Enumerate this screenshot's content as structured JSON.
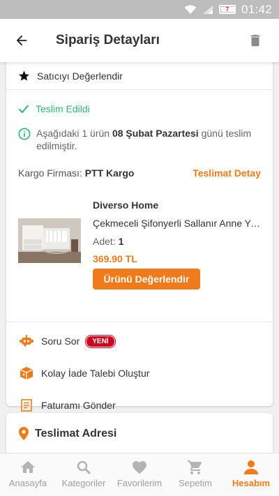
{
  "status_bar": {
    "time": "01:42",
    "battery_level": "7"
  },
  "header": {
    "title": "Sipariş Detayları",
    "back_icon": "arrow-back-icon",
    "delete_icon": "trash-icon"
  },
  "rate_seller": {
    "label": "Satıcıyı Değerlendir"
  },
  "delivery": {
    "status": "Teslim Edildi",
    "status_color": "#2eb872",
    "info_prefix": "Aşağıdaki 1 ürün",
    "info_date": "08 Şubat Pazartesi",
    "info_suffix": "günü teslim edilmiştir."
  },
  "cargo": {
    "label": "Kargo Firması:",
    "company": "PTT Kargo",
    "detail_link": "Teslimat Detay"
  },
  "product": {
    "brand": "Diverso Home",
    "name": "Çekmeceli Şifonyerli Sallanır Anne Yanı Bebek Beşiği",
    "qty_label": "Adet:",
    "qty": "1",
    "price": "369.90 TL",
    "rate_button": "Ürünü Değerlendir"
  },
  "actions": {
    "ask": "Soru Sor",
    "ask_badge": "YENİ",
    "return": "Kolay İade Talebi Oluştur",
    "invoice": "Faturamı Gönder"
  },
  "address": {
    "title": "Teslimat Adresi"
  },
  "bottom_nav": {
    "home": "Anasayfa",
    "categories": "Kategoriler",
    "favorites": "Favorilerim",
    "cart": "Sepetim",
    "account": "Hesabım"
  },
  "colors": {
    "accent": "#f27a1a",
    "success": "#2eb872",
    "badge": "#d0021b"
  }
}
